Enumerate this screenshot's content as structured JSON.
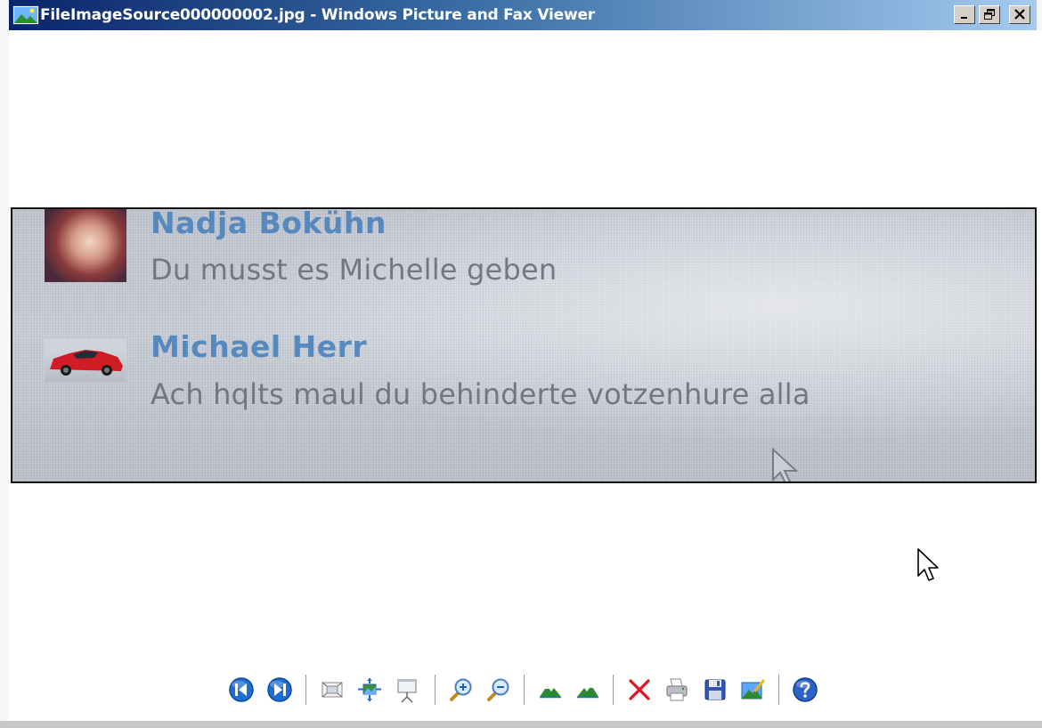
{
  "window": {
    "title": "FileImageSource000000002.jpg - Windows Picture and Fax Viewer",
    "app_icon": "picture-viewer-icon",
    "controls": [
      "minimize-icon",
      "restore-icon",
      "close-icon"
    ]
  },
  "photo": {
    "posts": [
      {
        "name": "Nadja Bokühn",
        "message": "Du musst es Michelle geben",
        "avatar": "avatar-photo"
      },
      {
        "name": "Michael Herr",
        "message": "Ach hqlts maul  du behinderte votzenhure alla",
        "avatar": "red-car-avatar"
      }
    ]
  },
  "toolbar": {
    "buttons": [
      {
        "name": "previous-image-button",
        "icon": "previous-icon"
      },
      {
        "name": "next-image-button",
        "icon": "next-icon"
      },
      {
        "name": "best-fit-button",
        "icon": "best-fit-icon"
      },
      {
        "name": "actual-size-button",
        "icon": "actual-size-icon"
      },
      {
        "name": "slideshow-button",
        "icon": "slideshow-icon"
      },
      {
        "name": "zoom-in-button",
        "icon": "zoom-in-icon"
      },
      {
        "name": "zoom-out-button",
        "icon": "zoom-out-icon"
      },
      {
        "name": "rotate-clockwise-button",
        "icon": "rotate-clockwise-icon"
      },
      {
        "name": "rotate-counterclockwise-button",
        "icon": "rotate-counterclockwise-icon"
      },
      {
        "name": "delete-button",
        "icon": "delete-icon"
      },
      {
        "name": "print-button",
        "icon": "print-icon"
      },
      {
        "name": "save-copy-button",
        "icon": "save-icon"
      },
      {
        "name": "edit-image-button",
        "icon": "edit-icon"
      },
      {
        "name": "help-button",
        "icon": "help-icon"
      }
    ]
  },
  "colors": {
    "title_bar_start": "#0a246a",
    "title_bar_end": "#a6caf0",
    "post_name": "#4d84bd",
    "post_message": "#6a6f78",
    "toolbar_blue": "#1c6fd1",
    "delete_red": "#e0141e"
  }
}
